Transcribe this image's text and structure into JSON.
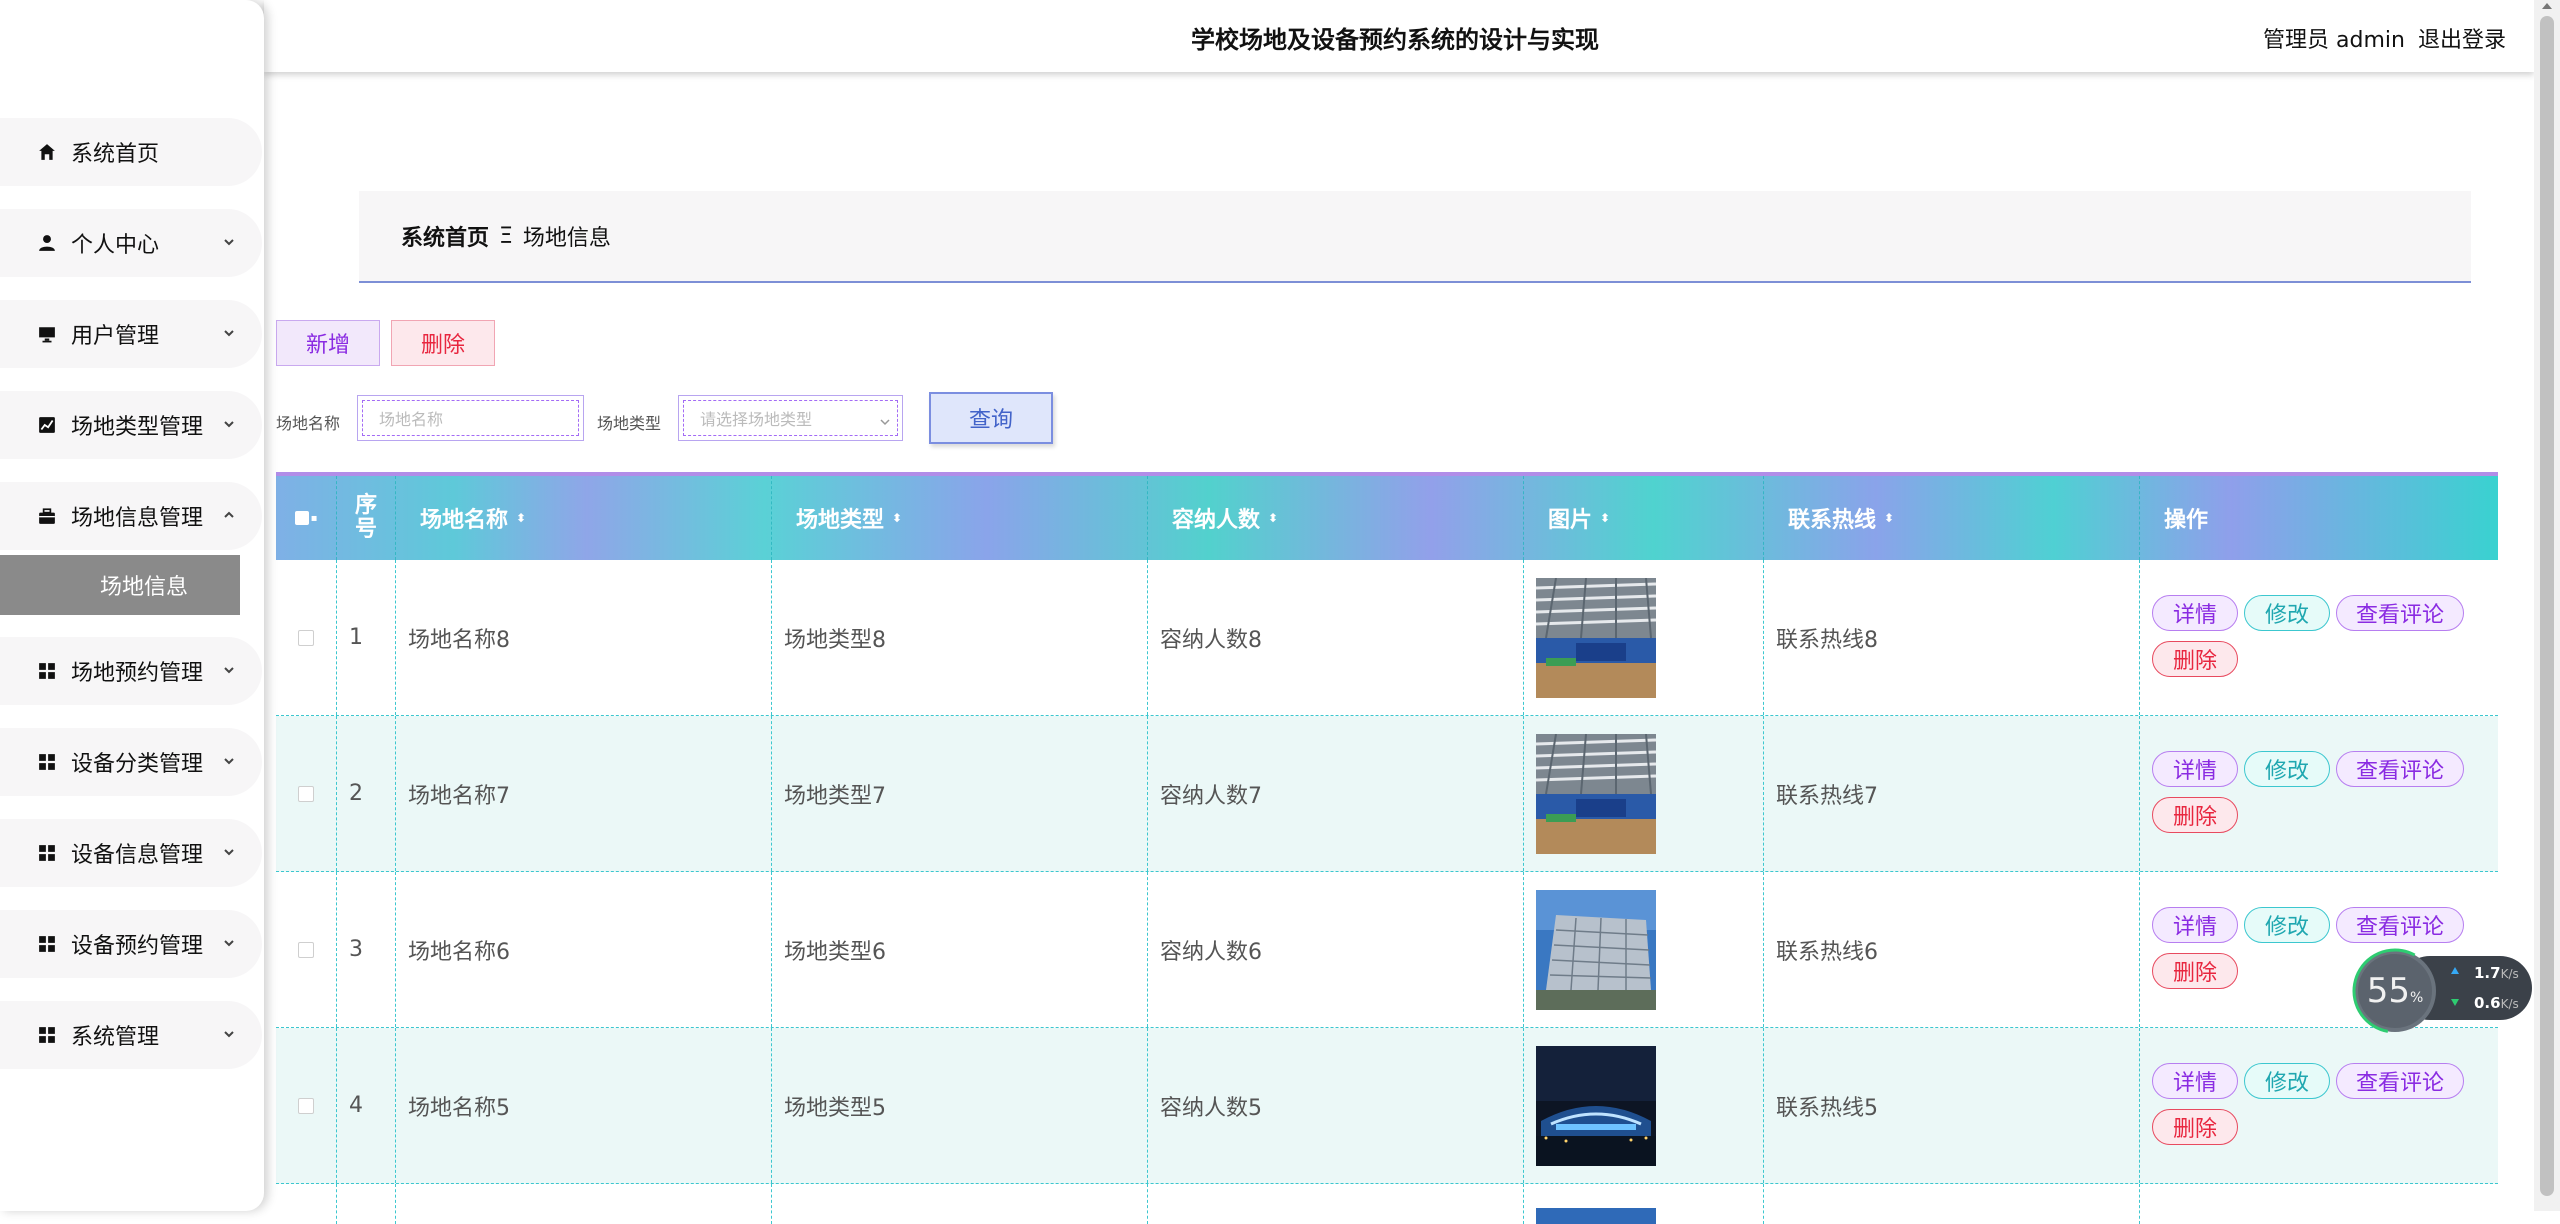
{
  "header": {
    "title": "学校场地及设备预约系统的设计与实现",
    "admin": "管理员 admin",
    "logout": "退出登录"
  },
  "sidebar": {
    "items": [
      {
        "label": "系统首页",
        "icon": "home-icon",
        "expandable": false
      },
      {
        "label": "个人中心",
        "icon": "user-icon",
        "expandable": true
      },
      {
        "label": "用户管理",
        "icon": "monitor-icon",
        "expandable": true
      },
      {
        "label": "场地类型管理",
        "icon": "chart-icon",
        "expandable": true
      },
      {
        "label": "场地信息管理",
        "icon": "briefcase-icon",
        "expandable": true,
        "expanded": true
      },
      {
        "label": "场地预约管理",
        "icon": "grid-icon",
        "expandable": true
      },
      {
        "label": "设备分类管理",
        "icon": "grid-icon",
        "expandable": true
      },
      {
        "label": "设备信息管理",
        "icon": "grid-icon",
        "expandable": true
      },
      {
        "label": "设备预约管理",
        "icon": "grid-icon",
        "expandable": true
      },
      {
        "label": "系统管理",
        "icon": "grid-icon",
        "expandable": true
      }
    ],
    "active_sub": "场地信息"
  },
  "breadcrumb": {
    "home": "系统首页",
    "separator": "Ξ",
    "current": "场地信息"
  },
  "actions": {
    "add": "新增",
    "delete": "删除"
  },
  "search": {
    "name_label": "场地名称",
    "name_placeholder": "场地名称",
    "type_label": "场地类型",
    "type_placeholder": "请选择场地类型",
    "query": "查询"
  },
  "table": {
    "headers": {
      "index": "序号",
      "name": "场地名称",
      "type": "场地类型",
      "capacity": "容纳人数",
      "image": "图片",
      "phone": "联系热线",
      "ops": "操作"
    },
    "rows": [
      {
        "index": "1",
        "name": "场地名称8",
        "type": "场地类型8",
        "capacity": "容纳人数8",
        "phone": "联系热线8"
      },
      {
        "index": "2",
        "name": "场地名称7",
        "type": "场地类型7",
        "capacity": "容纳人数7",
        "phone": "联系热线7"
      },
      {
        "index": "3",
        "name": "场地名称6",
        "type": "场地类型6",
        "capacity": "容纳人数6",
        "phone": "联系热线6"
      },
      {
        "index": "4",
        "name": "场地名称5",
        "type": "场地类型5",
        "capacity": "容纳人数5",
        "phone": "联系热线5"
      }
    ],
    "op_labels": {
      "detail": "详情",
      "edit": "修改",
      "review": "查看评论",
      "delete": "删除"
    }
  },
  "net_widget": {
    "percent": "55",
    "percent_unit": "%",
    "upload": "1.7",
    "download": "0.6",
    "unit": "K/s"
  },
  "colors": {
    "accent_purple": "#8a2be2",
    "accent_teal": "#3cc7cf",
    "danger": "#e8263f"
  }
}
